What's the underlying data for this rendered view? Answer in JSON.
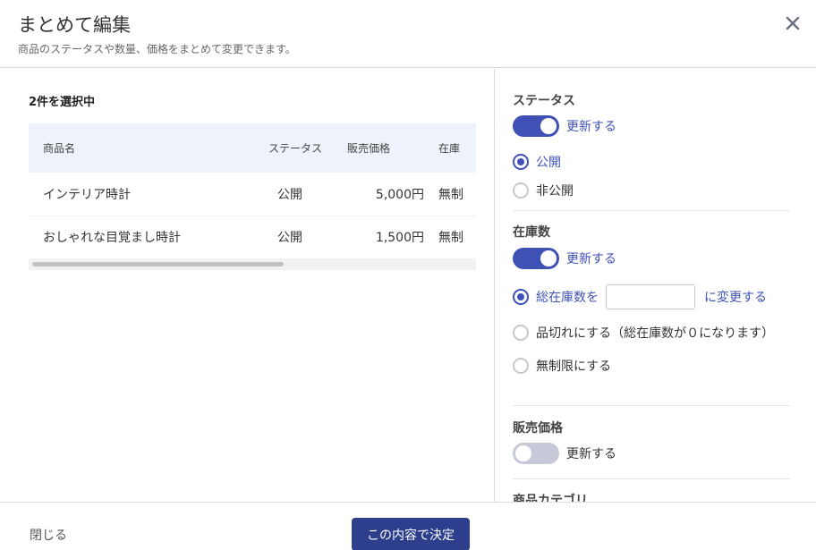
{
  "header": {
    "title": "まとめて編集",
    "subtitle": "商品のステータスや数量、価格をまとめて変更できます。"
  },
  "left": {
    "selected_count": "2件を選択中",
    "table": {
      "columns": [
        "商品名",
        "ステータス",
        "販売価格",
        "在庫"
      ],
      "rows": [
        {
          "name": "インテリア時計",
          "status": "公開",
          "price": "5,000円",
          "stock": "無制"
        },
        {
          "name": "おしゃれな目覚まし時計",
          "status": "公開",
          "price": "1,500円",
          "stock": "無制"
        }
      ]
    }
  },
  "right": {
    "status": {
      "title": "ステータス",
      "toggle_label": "更新する",
      "toggle_on": true,
      "options": [
        "公開",
        "非公開"
      ],
      "selected": "公開"
    },
    "stock": {
      "title": "在庫数",
      "toggle_label": "更新する",
      "toggle_on": true,
      "option_total_prefix": "総在庫数を",
      "option_total_value": "",
      "option_total_suffix": "に変更する",
      "option_soldout": "品切れにする（総在庫数が０になります）",
      "option_unlimited": "無制限にする",
      "selected": "総在庫数を"
    },
    "price": {
      "title": "販売価格",
      "toggle_label": "更新する",
      "toggle_on": false
    },
    "category": {
      "title": "商品カテゴリ"
    }
  },
  "footer": {
    "close_label": "閉じる",
    "submit_label": "この内容で決定"
  },
  "colors": {
    "accent": "#3f51b5",
    "button": "#2c3e8c",
    "table_header_bg": "#eef2fa"
  }
}
